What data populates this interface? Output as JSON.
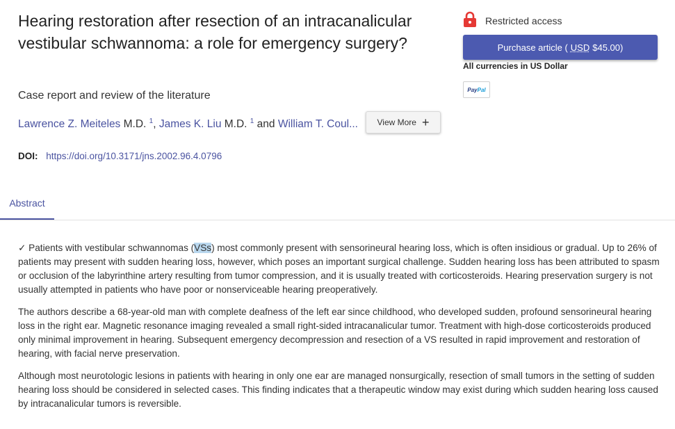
{
  "article": {
    "title": "Hearing restoration after resection of an intracanalicular vestibular schwannoma: a role for emergency surgery?",
    "subtitle": "Case report and review of the literature",
    "authors": [
      {
        "name": "Lawrence Z. Meiteles",
        "degree": "M.D.",
        "sup": "1"
      },
      {
        "name": "James K. Liu",
        "degree": "M.D.",
        "sup": "1"
      },
      {
        "name": "William T. Coul...",
        "degree": "",
        "sup": ""
      }
    ],
    "and": "and",
    "view_more": "View More",
    "doi_label": "DOI:",
    "doi_url": "https://doi.org/10.3171/jns.2002.96.4.0796"
  },
  "access": {
    "label": "Restricted access",
    "icon": "lock-icon",
    "icon_color": "#e53935",
    "purchase_prefix": "Purchase article (",
    "purchase_currency": "USD",
    "purchase_price": "$45.00)",
    "currencies_note": "All currencies in US Dollar",
    "paypal_pay": "Pay",
    "paypal_pal": "Pal"
  },
  "tabs": {
    "abstract": "Abstract"
  },
  "abstract": {
    "p1_check": "✓",
    "p1_a": " Patients with vestibular schwannomas (",
    "p1_hl": "VSs",
    "p1_b": ") most commonly present with sensorineural hearing loss, which is often insidious or gradual. Up to 26% of patients may present with sudden hearing loss, however, which poses an important surgical challenge. Sudden hearing loss has been attributed to spasm or occlusion of the labyrinthine artery resulting from tumor compression, and it is usually treated with corticosteroids. Hearing preservation surgery is not usually attempted in patients who have poor or nonserviceable hearing preoperatively.",
    "p2": "The authors describe a 68-year-old man with complete deafness of the left ear since childhood, who developed sudden, profound sensorineural hearing loss in the right ear. Magnetic resonance imaging revealed a small right-sided intracanalicular tumor. Treatment with high-dose corticosteroids produced only minimal improvement in hearing. Subsequent emergency decompression and resection of a VS resulted in rapid improvement and restoration of hearing, with facial nerve preservation.",
    "p3": "Although most neurotologic lesions in patients with hearing in only one ear are managed nonsurgically, resection of small tumors in the setting of sudden hearing loss should be considered in selected cases. This finding indicates that a therapeutic window may exist during which sudden hearing loss caused by intracanalicular tumors is reversible."
  },
  "colors": {
    "link": "#4a53a0",
    "purchase_button": "#4c5ab0",
    "highlight": "#b9d7ee"
  }
}
